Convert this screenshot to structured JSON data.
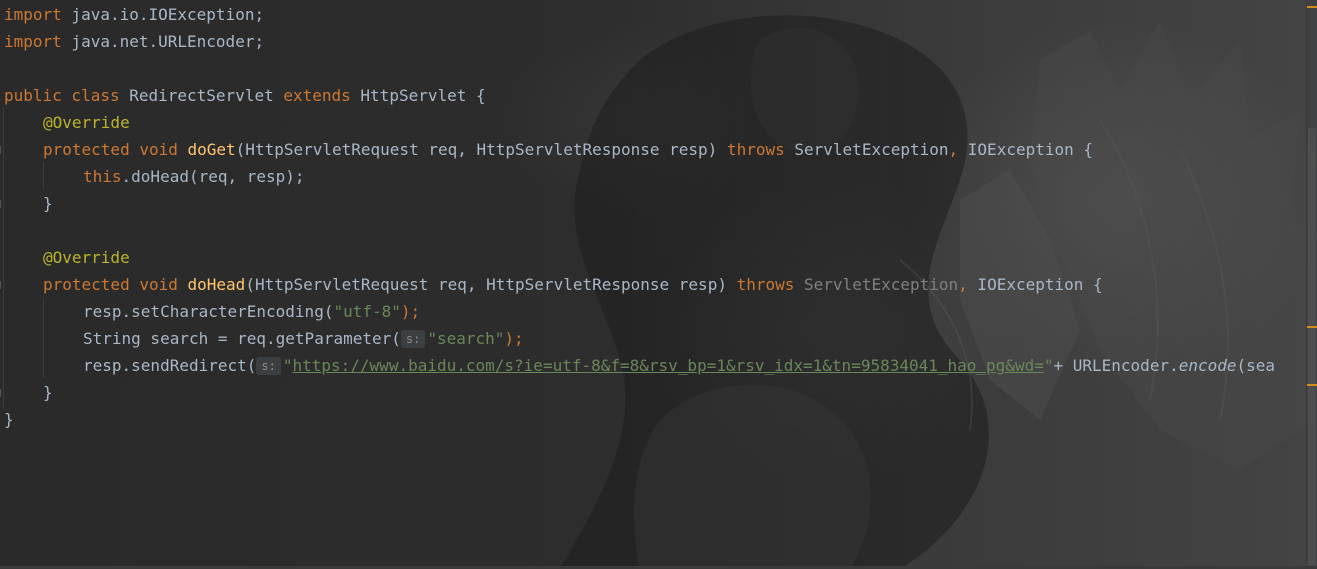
{
  "editor": {
    "language": "java",
    "colors": {
      "keyword": "#cc7832",
      "annotation": "#bbb529",
      "method_declaration": "#ffc66d",
      "string": "#6a8759",
      "default_text": "#a9b7c6",
      "warning_marker": "#d48c1f"
    },
    "lines": {
      "l1": {
        "kw": "import",
        "rest": " java.io.IOException;"
      },
      "l2": {
        "kw": "import",
        "rest": " java.net.URLEncoder;"
      },
      "l4": {
        "kw1": "public",
        "kw2": " class",
        "name": " RedirectServlet",
        "kw3": " extends",
        "parent": " HttpServlet {"
      },
      "l5": {
        "ann": "@Override"
      },
      "l6": {
        "kw1": "protected",
        "kw2": " void",
        "fn": " doGet",
        "params": "(HttpServletRequest req, HttpServletResponse resp)",
        "kw3": " throws",
        "exc1": " ServletException",
        "sep": ",",
        "exc2": " IOException {"
      },
      "l7": {
        "kw": "this",
        "rest": ".doHead(req, resp);"
      },
      "l8": {
        "text": "}"
      },
      "l10": {
        "ann": "@Override"
      },
      "l11": {
        "kw1": "protected",
        "kw2": " void",
        "fn": " doHead",
        "params": "(HttpServletRequest req, HttpServletResponse resp)",
        "kw3": " throws",
        "exc1": " ServletException",
        "sep": ",",
        "exc2": " IOException {"
      },
      "l12": {
        "pre": "resp.setCharacterEncoding(",
        "str": "\"utf-8\"",
        "post": ");"
      },
      "l13": {
        "pre": "String search = req.getParameter(",
        "hint": "s:",
        "str": "\"search\"",
        "post": ");"
      },
      "l14": {
        "pre": "resp.sendRedirect(",
        "hint": "s:",
        "quote_open": "\"",
        "url": "https://www.baidu.com/s?ie=utf-8&f=8&rsv_bp=1&rsv_idx=1&tn=95834041_hao_pg&wd=",
        "quote_close": "\"",
        "mid": "+ URLEncoder.",
        "method": "encode",
        "post": "(sea"
      },
      "l15": {
        "text": "}"
      },
      "l16": {
        "text": "}"
      }
    }
  }
}
